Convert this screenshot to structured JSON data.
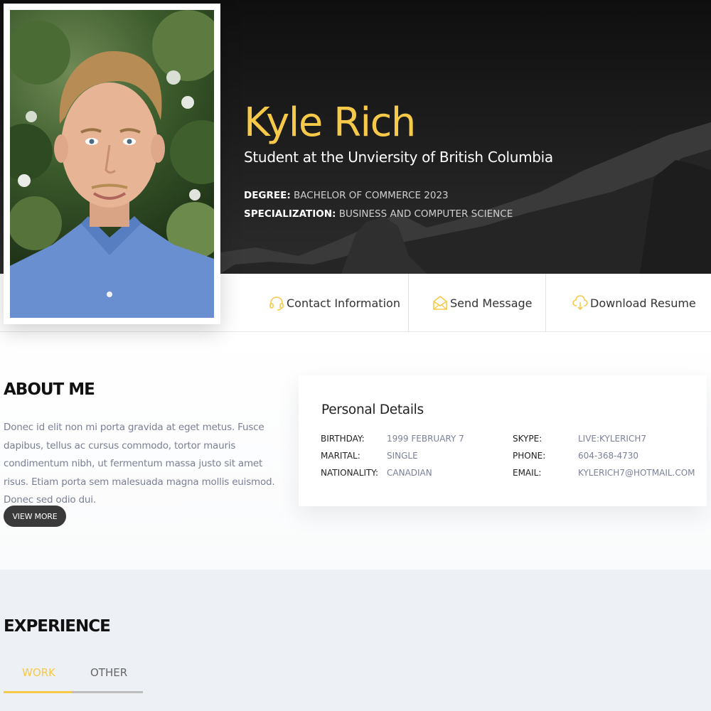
{
  "hero": {
    "name": "Kyle Rich",
    "subtitle": "Student at the Unviersity of British Columbia",
    "degree_label": "DEGREE:",
    "degree_value": "BACHELOR OF COMMERCE 2023",
    "spec_label": "SPECIALIZATION:",
    "spec_value": "BUSINESS AND COMPUTER SCIENCE"
  },
  "actions": {
    "contact": {
      "label": "Contact Information",
      "icon": "headphones-icon"
    },
    "message": {
      "label": "Send Message",
      "icon": "envelope-open-icon"
    },
    "download": {
      "label": "Download Resume",
      "icon": "cloud-download-icon"
    }
  },
  "about": {
    "title": "ABOUT ME",
    "text": "Donec id elit non mi porta gravida at eget metus. Fusce dapibus, tellus ac cursus commodo, tortor mauris condimentum nibh, ut fermentum massa justo sit amet risus. Etiam porta sem malesuada magna mollis euismod. Donec sed odio dui.",
    "button": "VIEW MORE"
  },
  "details": {
    "title": "Personal Details",
    "left": [
      {
        "label": "BIRTHDAY:",
        "value": "1999 FEBRUARY 7"
      },
      {
        "label": "MARITAL:",
        "value": "SINGLE"
      },
      {
        "label": "NATIONALITY:",
        "value": "CANADIAN"
      }
    ],
    "right": [
      {
        "label": "SKYPE:",
        "value": "LIVE:KYLERICH7"
      },
      {
        "label": "PHONE:",
        "value": "604-368-4730"
      },
      {
        "label": "EMAIL:",
        "value": "KYLERICH7@HOTMAIL.COM"
      }
    ]
  },
  "experience": {
    "title": "EXPERIENCE",
    "tabs": [
      "WORK",
      "OTHER"
    ],
    "active_tab": "WORK"
  },
  "colors": {
    "accent": "#f7c948",
    "dark": "#1a1a1a",
    "muted_text": "#7a7f94",
    "experience_bg": "#edf0f5"
  }
}
